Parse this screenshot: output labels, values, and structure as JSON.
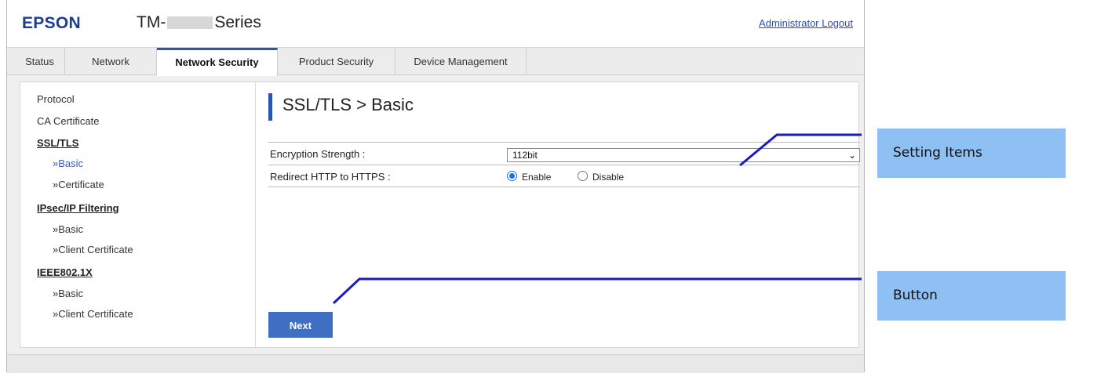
{
  "header": {
    "logo": "EPSON",
    "model_prefix": "TM-",
    "model_suffix": "Series",
    "logout_link": "Administrator Logout"
  },
  "tabs": [
    {
      "label": "Status"
    },
    {
      "label": "Network"
    },
    {
      "label": "Network Security",
      "active": true
    },
    {
      "label": "Product Security"
    },
    {
      "label": "Device Management"
    }
  ],
  "sidebar": {
    "items": [
      {
        "label": "Protocol",
        "type": "item"
      },
      {
        "label": "CA Certificate",
        "type": "item"
      },
      {
        "label": "SSL/TLS",
        "type": "head"
      },
      {
        "label": "»Basic",
        "type": "sub-active"
      },
      {
        "label": "»Certificate",
        "type": "sub"
      },
      {
        "label": "IPsec/IP Filtering",
        "type": "head"
      },
      {
        "label": "»Basic",
        "type": "sub"
      },
      {
        "label": "»Client Certificate",
        "type": "sub"
      },
      {
        "label": "IEEE802.1X",
        "type": "head"
      },
      {
        "label": "»Basic",
        "type": "sub"
      },
      {
        "label": "»Client Certificate",
        "type": "sub"
      }
    ]
  },
  "main": {
    "title": "SSL/TLS > Basic",
    "encryption_label": "Encryption Strength :",
    "encryption_value": "112bit",
    "redirect_label": "Redirect HTTP to HTTPS :",
    "redirect_enable": "Enable",
    "redirect_disable": "Disable",
    "redirect_selected": "Enable",
    "next_button": "Next"
  },
  "callouts": {
    "settings": "Setting Items",
    "button": "Button"
  },
  "colors": {
    "brand": "#1a3f8f",
    "accent": "#2a55b8",
    "button": "#3f6fc3",
    "callout": "#8fc0f4",
    "callout_line": "#1a1ac8"
  }
}
